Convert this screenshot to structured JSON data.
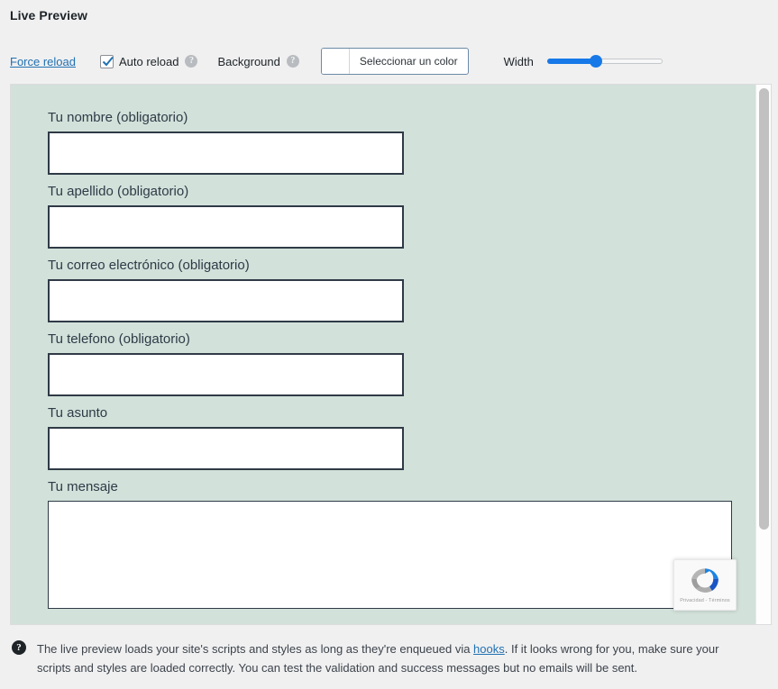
{
  "page_title": "Live Preview",
  "toolbar": {
    "force_reload": "Force reload",
    "auto_reload_label": "Auto reload",
    "auto_reload_checked": true,
    "auto_reload_help": "?",
    "background_label": "Background",
    "background_help": "?",
    "color_picker_label": "Seleccionar un color",
    "color_picker_value": "#ffffff",
    "width_label": "Width",
    "width_value_percent": 42
  },
  "preview": {
    "background_color": "#d2e1da",
    "border_color": "#2f3a46",
    "fields": [
      {
        "label": "Tu nombre (obligatorio)",
        "value": "",
        "type": "text"
      },
      {
        "label": "Tu apellido (obligatorio)",
        "value": "",
        "type": "text"
      },
      {
        "label": "Tu correo electrónico (obligatorio)",
        "value": "",
        "type": "text"
      },
      {
        "label": "Tu telefono (obligatorio)",
        "value": "",
        "type": "text"
      },
      {
        "label": "Tu asunto",
        "value": "",
        "type": "text"
      },
      {
        "label": "Tu mensaje",
        "value": "",
        "type": "textarea"
      }
    ],
    "recaptcha": {
      "privacy_terms": "Privacidad - Términos"
    }
  },
  "footer": {
    "help_icon": "?",
    "text_before_link": "The live preview loads your site's scripts and styles as long as they're enqueued via ",
    "link_text": "hooks",
    "text_after_link": ". If it looks wrong for you, make sure your scripts and styles are loaded correctly. You can test the validation and success messages but no emails will be sent."
  }
}
